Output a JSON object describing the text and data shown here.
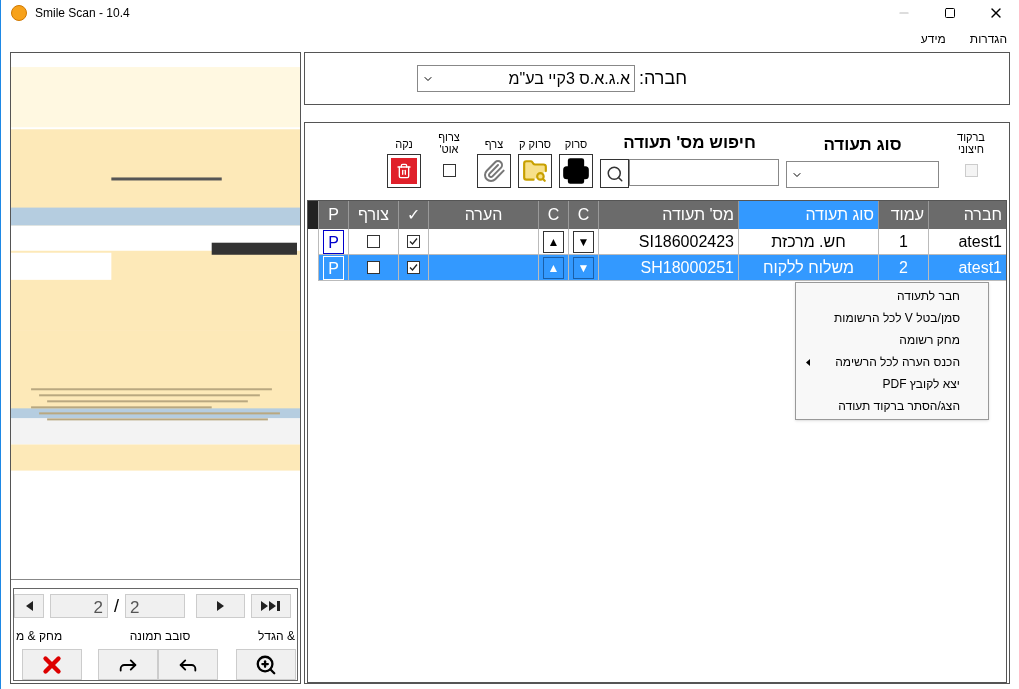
{
  "window": {
    "title": "Smile Scan - 10.4"
  },
  "menu": [
    {
      "label": "הגדרות"
    },
    {
      "label": "מידע"
    }
  ],
  "company": {
    "label": "חברה:",
    "value": "א.ג.א.ס 3קיי בע\"מ"
  },
  "toolbar": {
    "barcode": {
      "label": "ברקוד חיצוני",
      "checked": false,
      "disabled": true
    },
    "doc_type": {
      "label": "סוג תעודה"
    },
    "search": {
      "label": "חיפוש מס' תעודה"
    },
    "buttons": [
      {
        "label": "סרוק",
        "kind": "printer"
      },
      {
        "label": "סרוק ק",
        "kind": "folder"
      },
      {
        "label": "צרף",
        "kind": "paperclip"
      }
    ],
    "auto_attach": {
      "label": "צרוף אוט'",
      "checked": false
    },
    "clear": {
      "label": "נקה"
    }
  },
  "table": {
    "columns": [
      {
        "label": "חברה",
        "selected": false
      },
      {
        "label": "עמוד",
        "selected": false
      },
      {
        "label": "סוג תעודה",
        "selected": true
      },
      {
        "label": "מס' תעודה",
        "selected": false
      },
      {
        "label": "C",
        "selected": false
      },
      {
        "label": "C",
        "selected": false
      },
      {
        "label": "הערה",
        "selected": false
      },
      {
        "label": "✓",
        "selected": false
      },
      {
        "label": "צורף",
        "selected": false
      },
      {
        "label": "P",
        "selected": false
      }
    ],
    "rows": [
      {
        "company": "atest1",
        "page": "1",
        "doc_type": "חש. מרכזת",
        "doc_no": "SI186002423",
        "down": "▼",
        "up": "▲",
        "checked": true,
        "attached": false,
        "p": "P",
        "selected": false
      },
      {
        "company": "atest1",
        "page": "2",
        "doc_type": "משלוח ללקוח",
        "doc_no": "SH18000251",
        "down": "▼",
        "up": "▲",
        "checked": true,
        "attached": false,
        "p": "P",
        "selected": true
      }
    ]
  },
  "context_menu": [
    {
      "label": "חבר לתעודה",
      "submenu": false
    },
    {
      "label": "סמן/בטל V לכל הרשומות",
      "submenu": false
    },
    {
      "label": "מחק רשומה",
      "submenu": false
    },
    {
      "label": "הכנס הערה לכל הרשימה",
      "submenu": true
    },
    {
      "label": "יצא לקובץ PDF",
      "submenu": false
    },
    {
      "label": "הצג/הסתר ברקוד תעודה",
      "submenu": false
    }
  ],
  "preview": {
    "page": "2",
    "separator": "/",
    "total": "2",
    "labels": [
      {
        "label": "& הגדל"
      },
      {
        "label": "סובב תמונה"
      },
      {
        "label": "מחק & מ"
      }
    ]
  }
}
